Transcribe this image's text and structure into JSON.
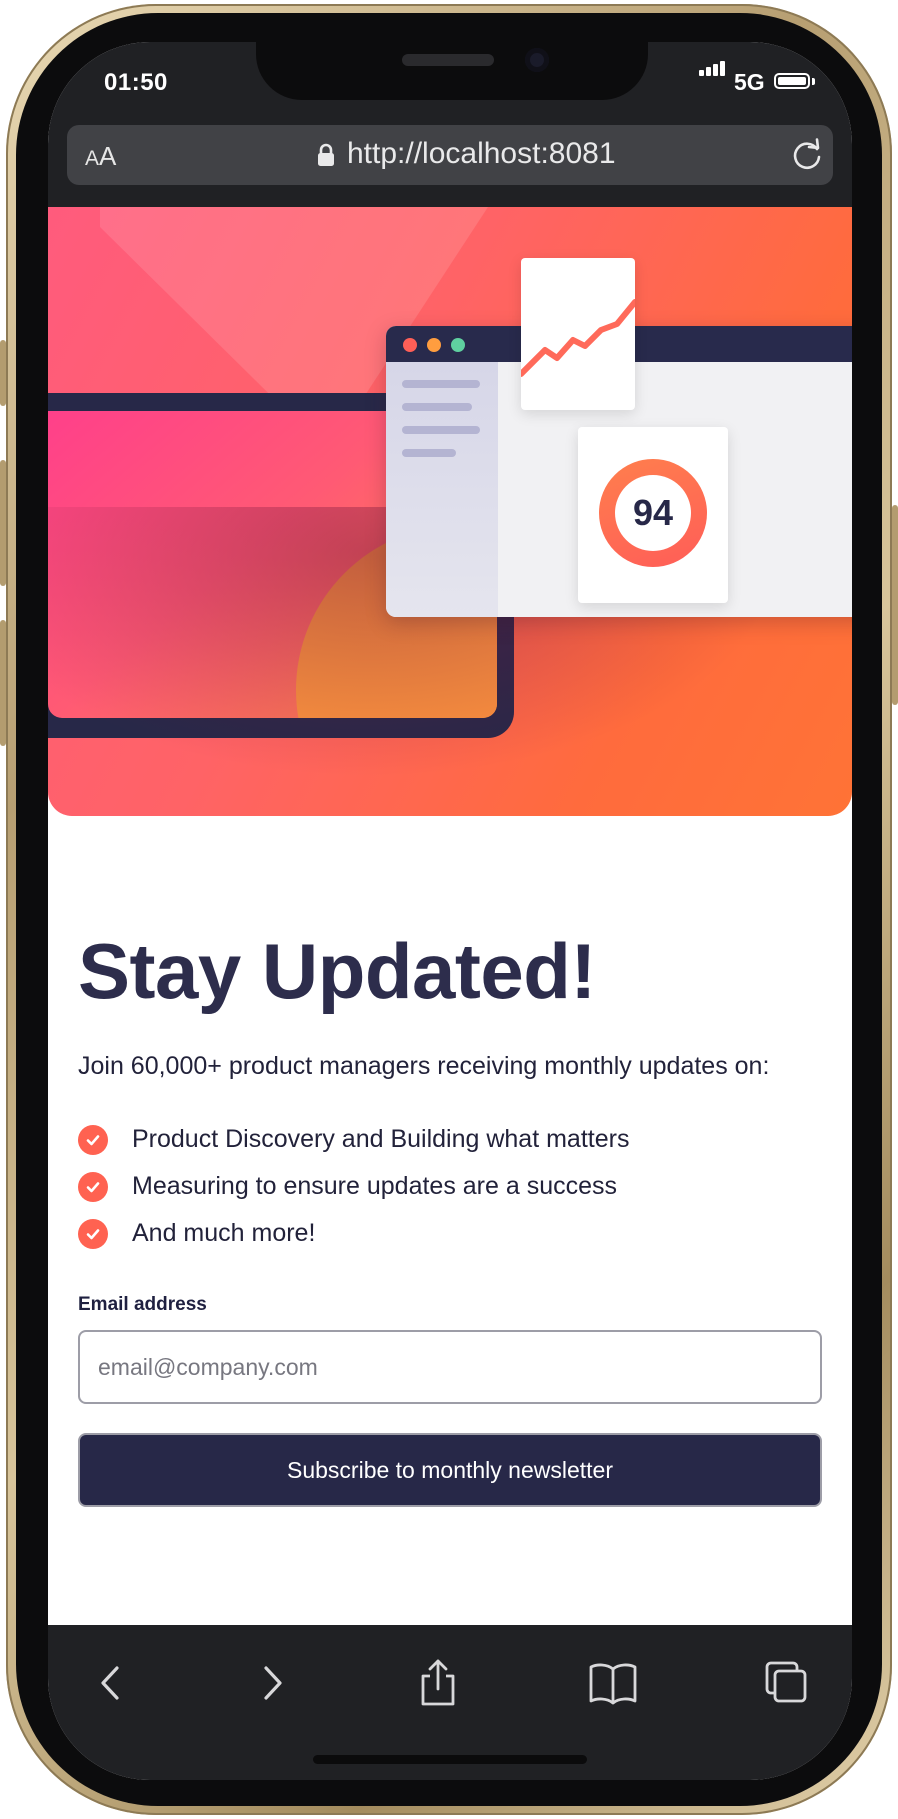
{
  "status": {
    "time": "01:50",
    "network": "5G",
    "signal_bars": 4,
    "battery_level": 1.0
  },
  "browser": {
    "text_size_label_small": "A",
    "text_size_label_large": "A",
    "url": "http://localhost:8081"
  },
  "hero": {
    "score": "94"
  },
  "page": {
    "title": "Stay Updated!",
    "intro": "Join 60,000+ product managers receiving monthly updates on:",
    "features": [
      "Product Discovery and Building what matters",
      "Measuring to ensure updates are a success",
      "And much more!"
    ],
    "email_label": "Email address",
    "email_placeholder": "email@company.com",
    "email_value": "",
    "submit_label": "Subscribe to monthly newsletter"
  },
  "toolbar": {
    "icons": [
      "back-icon",
      "forward-icon",
      "share-icon",
      "bookmarks-icon",
      "tabs-icon"
    ]
  },
  "colors": {
    "accent": "#ff6251",
    "navy": "#272848",
    "title": "#2d2d4c",
    "chrome": "#202124"
  }
}
